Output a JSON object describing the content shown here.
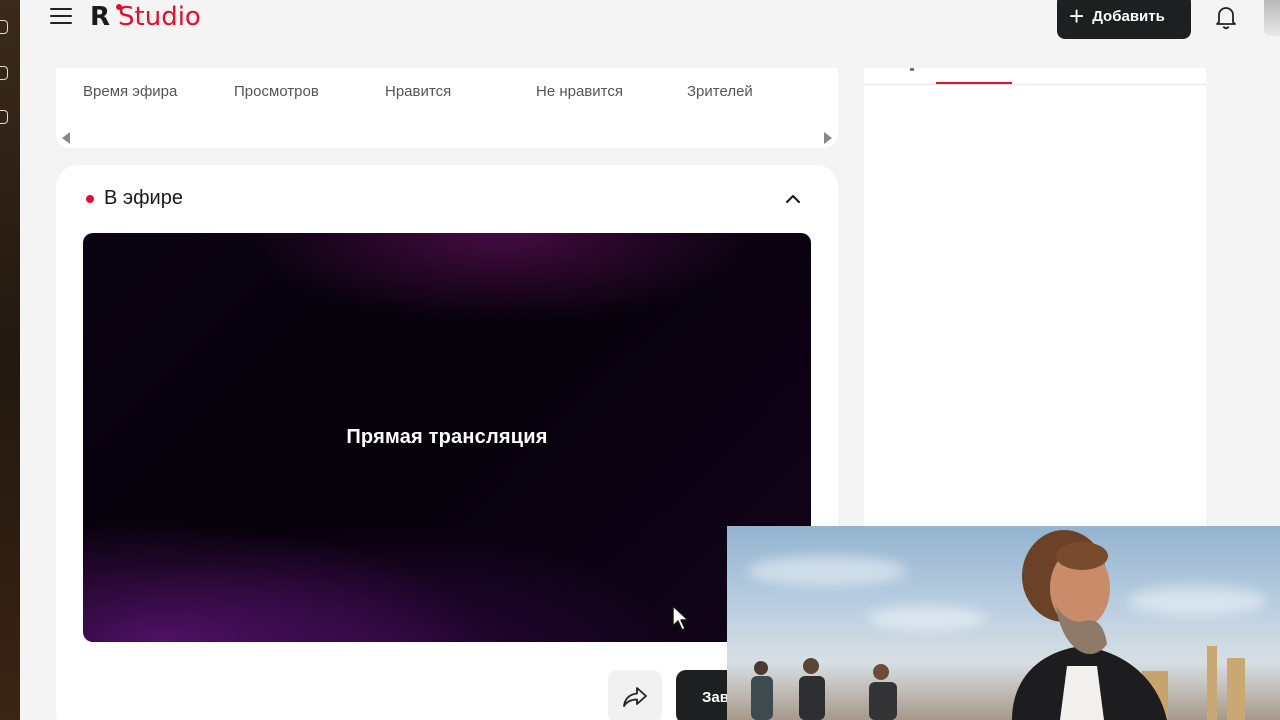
{
  "header": {
    "logo_letter": "R",
    "logo_text": "Studio",
    "add_button_label": "Добавить"
  },
  "stats": {
    "columns": [
      "Время эфира",
      "Просмотров",
      "Нравится",
      "Не нравится",
      "Зрителей"
    ]
  },
  "live": {
    "title": "В эфире",
    "player_label": "Прямая трансляция",
    "end_button_label": "Зав"
  },
  "colors": {
    "accent": "#e0102e",
    "dark_button": "#1e1f21",
    "page_bg": "#f4f4f5"
  },
  "icons": [
    "menu-icon",
    "plus-icon",
    "bell-icon",
    "chevron-up-icon",
    "share-icon",
    "scroll-left-icon",
    "scroll-right-icon",
    "cursor-icon"
  ]
}
